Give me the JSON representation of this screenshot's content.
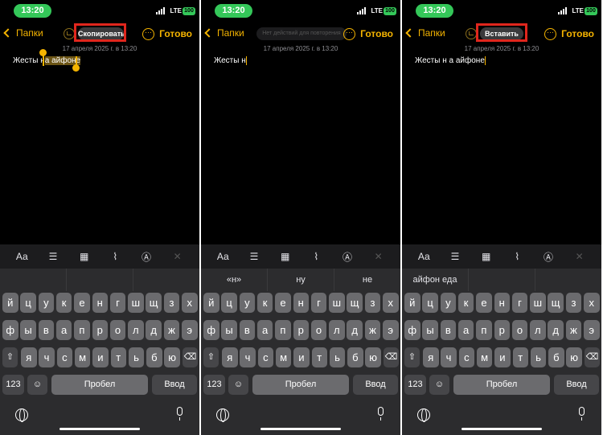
{
  "screens": [
    {
      "status": {
        "time": "13:20",
        "network": "LTE",
        "battery": "100"
      },
      "nav": {
        "back_label": "Папки",
        "done_label": "Готово",
        "menu_label": "Скопировать",
        "menu_disabled": false
      },
      "note": {
        "date": "17 апреля 2025 г. в 13:20",
        "text_before": "Жесты н",
        "text_selected": "а айфоне",
        "text_after": ""
      },
      "suggestions": [
        "",
        "",
        ""
      ]
    },
    {
      "status": {
        "time": "13:20",
        "network": "LTE",
        "battery": "100"
      },
      "nav": {
        "back_label": "Папки",
        "done_label": "Готово",
        "menu_label": "Нет действий для повторения",
        "menu_disabled": true
      },
      "note": {
        "date": "17 апреля 2025 г. в 13:20",
        "text_before": "Жесты н",
        "text_selected": "",
        "text_after": ""
      },
      "suggestions": [
        "«н»",
        "ну",
        "не"
      ]
    },
    {
      "status": {
        "time": "13:20",
        "network": "LTE",
        "battery": "100"
      },
      "nav": {
        "back_label": "Папки",
        "done_label": "Готово",
        "menu_label": "Вставить",
        "menu_disabled": false
      },
      "note": {
        "date": "17 апреля 2025 г. в 13:20",
        "text_before": "Жесты н а айфоне",
        "text_selected": "",
        "text_after": ""
      },
      "suggestions": [
        "айфон еда",
        "",
        ""
      ]
    }
  ],
  "toolbar": {
    "format_label": "Аа",
    "icons": [
      "checklist-icon",
      "table-icon",
      "attachment-icon",
      "markup-icon",
      "close-icon"
    ]
  },
  "keyboard": {
    "row1": [
      "й",
      "ц",
      "у",
      "к",
      "е",
      "н",
      "г",
      "ш",
      "щ",
      "з",
      "х"
    ],
    "row2": [
      "ф",
      "ы",
      "в",
      "а",
      "п",
      "р",
      "о",
      "л",
      "д",
      "ж",
      "э"
    ],
    "row3": [
      "я",
      "ч",
      "с",
      "м",
      "и",
      "т",
      "ь",
      "б",
      "ю"
    ],
    "numbers_label": "123",
    "space_label": "Пробел",
    "return_label": "Ввод",
    "shift_icon": "shift-icon",
    "delete_icon": "delete-icon",
    "emoji_icon": "emoji-icon",
    "globe_icon": "globe-icon",
    "mic_icon": "microphone-icon"
  },
  "accent_color": "#f5b400",
  "highlight_box_color": "#e0261d"
}
